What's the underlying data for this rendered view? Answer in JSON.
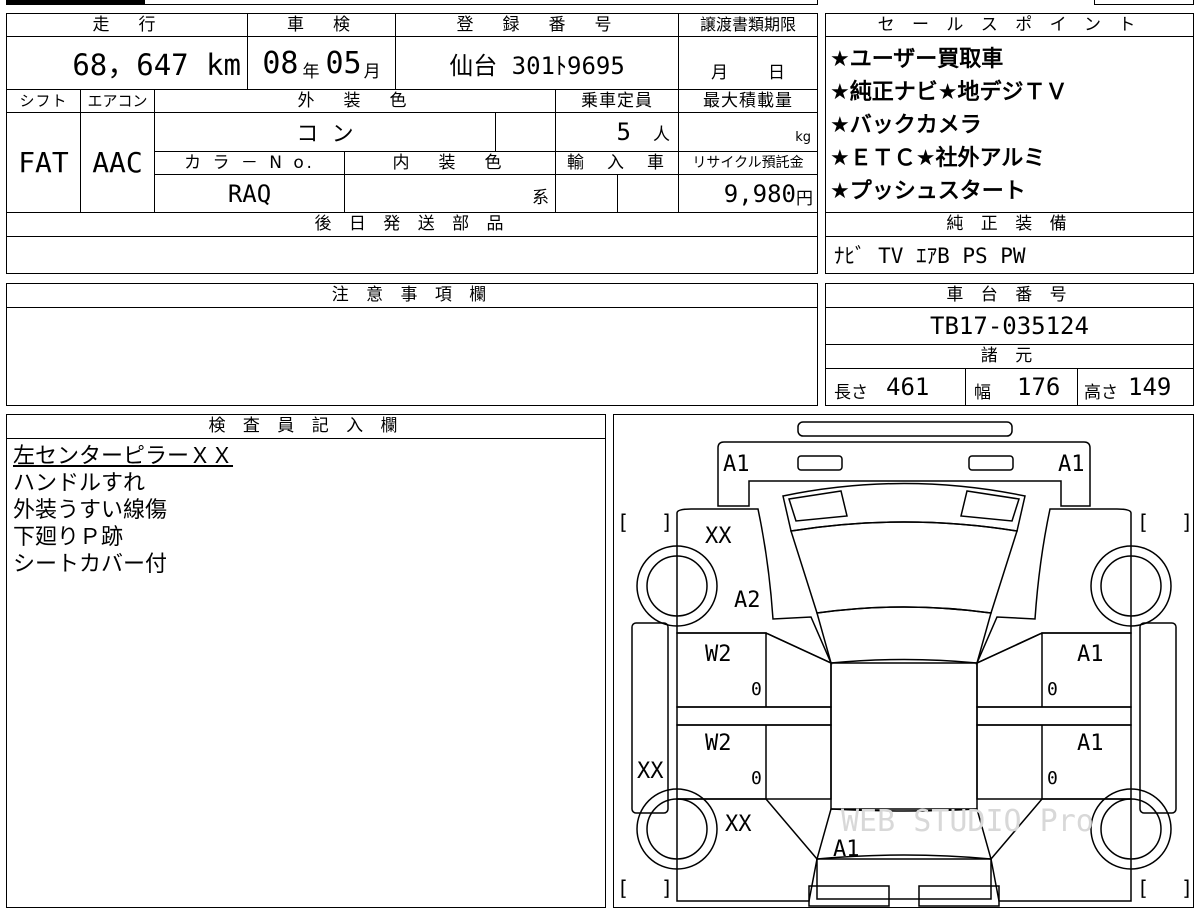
{
  "header": {
    "distance_label": "走　行",
    "inspection_label": "車　検",
    "registration_label": "登　録　番　号",
    "transfer_deadline_label": "譲渡書類期限",
    "distance_value": "68，647 km",
    "inspection_year": "08",
    "inspection_year_unit": "年",
    "inspection_month": "05",
    "inspection_month_unit": "月",
    "registration_value": "仙台 301ﾄ9695",
    "transfer_month_unit": "月",
    "transfer_day_unit": "日"
  },
  "row2": {
    "shift_label": "シフト",
    "aircon_label": "エアコン",
    "exterior_color_label": "外　装　色",
    "capacity_label": "乗車定員",
    "max_load_label": "最大積載量",
    "shift_value": "FAT",
    "aircon_value": "AAC",
    "exterior_color_value": "コ ン",
    "capacity_value": "5",
    "capacity_unit": "人",
    "max_load_unit": "kg",
    "color_no_label": "カ ラ － N o.",
    "interior_color_label": "内　装　色",
    "import_label": "輸　入　車",
    "recycle_label": "リサイクル預託金",
    "color_no_value": "RAQ",
    "interior_suffix": "系",
    "recycle_value": "9,980",
    "recycle_unit": "円"
  },
  "later_parts": {
    "label": "後 日 発 送 部 品",
    "value": ""
  },
  "sales_points": {
    "label": "セ ー ル ス ポ イ ン ト",
    "items": [
      "★ユーザー買取車",
      "★純正ナビ★地デジＴＶ",
      "★バックカメラ",
      "★ＥＴＣ★社外アルミ",
      "★プッシュスタート"
    ]
  },
  "equipment": {
    "label": "純 正 装 備",
    "value": "ﾅﾋﾞ TV ｴｱB PS PW"
  },
  "caution": {
    "label": "注 意 事 項 欄",
    "value": ""
  },
  "chassis": {
    "label": "車 台 番 号",
    "value": "TB17-035124"
  },
  "specs": {
    "label": "諸 元",
    "length_label": "長さ",
    "length_value": "461",
    "width_label": "幅",
    "width_value": "176",
    "height_label": "高さ",
    "height_value": "149"
  },
  "inspector": {
    "label": "検 査 員 記 入 欄",
    "notes": [
      "左センターピラーＸＸ",
      "ハンドルすれ",
      "外装うすい線傷",
      "下廻りＰ跡",
      "シートカバー付"
    ]
  },
  "diagram": {
    "marks": [
      "A1",
      "A1",
      "XX",
      "A2",
      "W2",
      "0",
      "W2",
      "0",
      "XX",
      "XX",
      "A1",
      "A1",
      "0",
      "A1",
      "0",
      "A1"
    ],
    "bracket_left": "[",
    "bracket_right": "]",
    "watermark": "WEB STUDIO Pro"
  }
}
